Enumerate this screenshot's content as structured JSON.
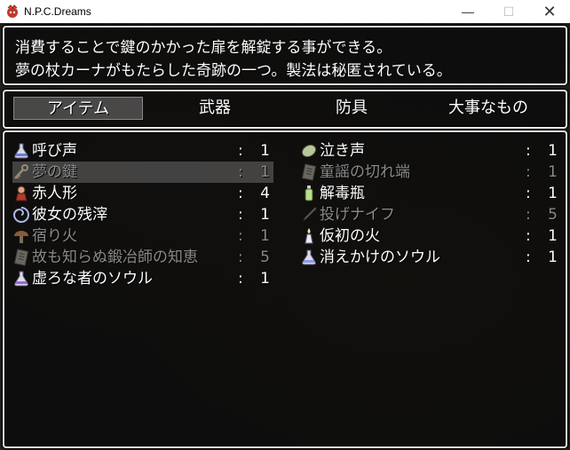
{
  "window": {
    "title": "N.P.C.Dreams",
    "controls": {
      "minimize": "—",
      "maximize": "☐",
      "close": "✕"
    }
  },
  "help": {
    "line1": "消費することで鍵のかかった扉を解錠する事ができる。",
    "line2": "夢の杖カーナがもたらした奇跡の一つ。製法は秘匿されている。"
  },
  "categories": [
    {
      "label": "アイテム",
      "selected": true
    },
    {
      "label": "武器"
    },
    {
      "label": "防具"
    },
    {
      "label": "大事なもの"
    }
  ],
  "separator": ":",
  "items_left": [
    {
      "icon": "flask-icon",
      "name": "呼び声",
      "qty": "1",
      "enabled": true
    },
    {
      "icon": "key-icon",
      "name": "夢の鍵",
      "qty": "1",
      "enabled": false,
      "selected": true
    },
    {
      "icon": "doll-icon",
      "name": "赤人形",
      "qty": "4",
      "enabled": true
    },
    {
      "icon": "swirl-icon",
      "name": "彼女の残滓",
      "qty": "1",
      "enabled": true
    },
    {
      "icon": "mushroom-icon",
      "name": "宿り火",
      "qty": "1",
      "enabled": false
    },
    {
      "icon": "scroll-icon",
      "name": "故も知らぬ鍛冶師の知恵",
      "qty": "5",
      "enabled": false
    },
    {
      "icon": "flask-icon",
      "name": "虚ろな者のソウル",
      "qty": "1",
      "enabled": true
    }
  ],
  "items_right": [
    {
      "icon": "seed-icon",
      "name": "泣き声",
      "qty": "1",
      "enabled": true
    },
    {
      "icon": "scroll-icon",
      "name": "童謡の切れ端",
      "qty": "1",
      "enabled": false
    },
    {
      "icon": "bottle-icon",
      "name": "解毒瓶",
      "qty": "1",
      "enabled": true
    },
    {
      "icon": "knife-icon",
      "name": "投げナイフ",
      "qty": "5",
      "enabled": false
    },
    {
      "icon": "candle-icon",
      "name": "仮初の火",
      "qty": "1",
      "enabled": true
    },
    {
      "icon": "flask-icon",
      "name": "消えかけのソウル",
      "qty": "1",
      "enabled": true
    }
  ]
}
